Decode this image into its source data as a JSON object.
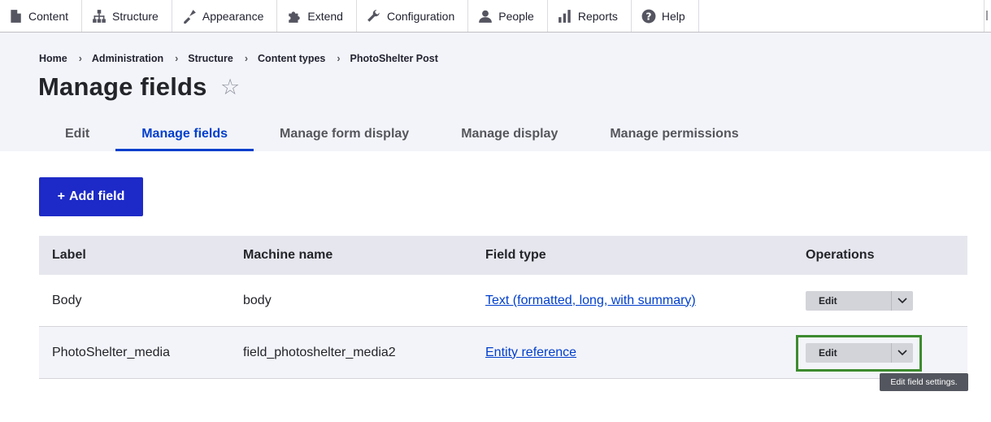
{
  "toolbar": {
    "items": [
      {
        "label": "Content",
        "icon": "content-icon"
      },
      {
        "label": "Structure",
        "icon": "structure-icon"
      },
      {
        "label": "Appearance",
        "icon": "appearance-icon"
      },
      {
        "label": "Extend",
        "icon": "extend-icon"
      },
      {
        "label": "Configuration",
        "icon": "configuration-icon"
      },
      {
        "label": "People",
        "icon": "people-icon"
      },
      {
        "label": "Reports",
        "icon": "reports-icon"
      },
      {
        "label": "Help",
        "icon": "help-icon"
      }
    ]
  },
  "breadcrumb": [
    "Home",
    "Administration",
    "Structure",
    "Content types",
    "PhotoShelter Post"
  ],
  "page": {
    "title": "Manage fields",
    "star": "☆"
  },
  "tabs": [
    {
      "label": "Edit",
      "active": false
    },
    {
      "label": "Manage fields",
      "active": true
    },
    {
      "label": "Manage form display",
      "active": false
    },
    {
      "label": "Manage display",
      "active": false
    },
    {
      "label": "Manage permissions",
      "active": false
    }
  ],
  "add_field": {
    "plus": "+",
    "label": "Add field"
  },
  "table": {
    "headers": [
      "Label",
      "Machine name",
      "Field type",
      "Operations"
    ],
    "rows": [
      {
        "label": "Body",
        "machine_name": "body",
        "field_type": "Text (formatted, long, with summary)",
        "operation": "Edit"
      },
      {
        "label": "PhotoShelter_media",
        "machine_name": "field_photoshelter_media2",
        "field_type": "Entity reference",
        "operation": "Edit"
      }
    ]
  },
  "tooltip": "Edit field settings.",
  "colors": {
    "accent": "#003ecc",
    "button_primary": "#1d2ac7",
    "focus_ring": "#3d8b2f",
    "header_bg": "#f3f4f9"
  }
}
